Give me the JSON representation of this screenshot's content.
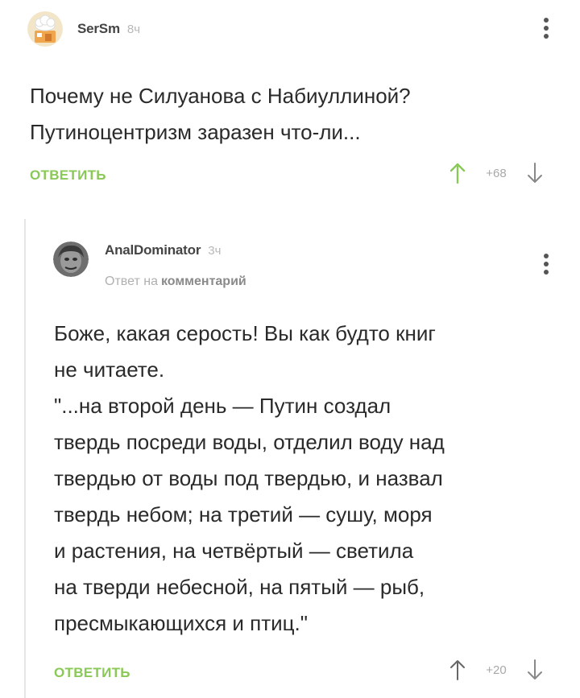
{
  "comments": [
    {
      "author": "SerSm",
      "time": "8ч",
      "text": "Почему не Силуанова с Набиуллиной?\nПутиноцентризм заразен что-ли...",
      "reply_label": "ОТВЕТИТЬ",
      "score": "+68",
      "avatar": "chef-hat-avatar"
    },
    {
      "author": "AnalDominator",
      "time": "3ч",
      "reply_to_prefix": "Ответ на",
      "reply_to_link": "комментарий",
      "text": "Боже, какая серость! Вы как будто книг\nне читаете.\n\"...на второй день — Путин создал\nтвердь посреди воды, отделил воду над\nтвердью от воды под твердью, и назвал\nтвердь небом; на третий — сушу, моря\nи растения, на четвёртый — светила\nна тверди небесной, на пятый — рыб,\nпресмыкающихся и птиц.\"",
      "reply_label": "ОТВЕТИТЬ",
      "score": "+20",
      "avatar": "portrait-avatar"
    }
  ],
  "colors": {
    "accent_green": "#8ac858",
    "upvote_green": "#8ac858",
    "muted": "#b8b8b8"
  },
  "icons": [
    "more-vertical-icon",
    "arrow-up-icon",
    "arrow-down-icon"
  ]
}
